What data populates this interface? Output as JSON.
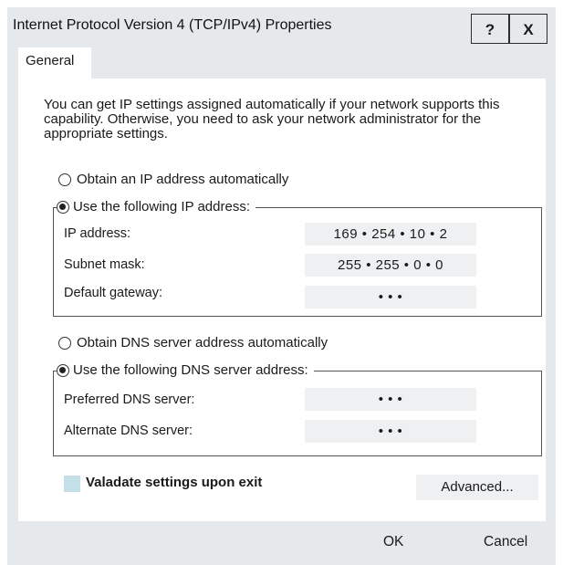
{
  "window": {
    "title": "Internet Protocol Version 4 (TCP/IPv4) Properties",
    "help_label": "?",
    "close_label": "X"
  },
  "tabs": [
    {
      "label": "General",
      "active": true
    }
  ],
  "description": "You can get IP settings assigned automatically if your network supports this capability. Otherwise, you need to ask your network administrator for the appropriate settings.",
  "ip": {
    "auto_label": "Obtain an IP address automatically",
    "manual_label": "Use the following IP address:",
    "selected": "manual",
    "fields": [
      {
        "label": "IP address:",
        "value": "169 • 254 • 10 • 2"
      },
      {
        "label": "Subnet mask:",
        "value": "255 • 255 • 0 • 0"
      },
      {
        "label": "Default gateway:",
        "value": "•      •      •"
      }
    ]
  },
  "dns": {
    "auto_label": "Obtain DNS server address automatically",
    "manual_label": "Use the following DNS server address:",
    "selected": "manual",
    "fields": [
      {
        "label": "Preferred DNS server:",
        "value": "•      •      •"
      },
      {
        "label": "Alternate DNS server:",
        "value": "•      •      •"
      }
    ]
  },
  "validate": {
    "label": "Valadate settings upon exit",
    "checked": false
  },
  "buttons": {
    "advanced": "Advanced...",
    "ok": "OK",
    "cancel": "Cancel"
  },
  "colors": {
    "window_bg": "#e6e9ec",
    "panel_bg": "#ffffff",
    "input_bg": "#eef0f2",
    "checkbox_bg": "#c3dfe8"
  }
}
